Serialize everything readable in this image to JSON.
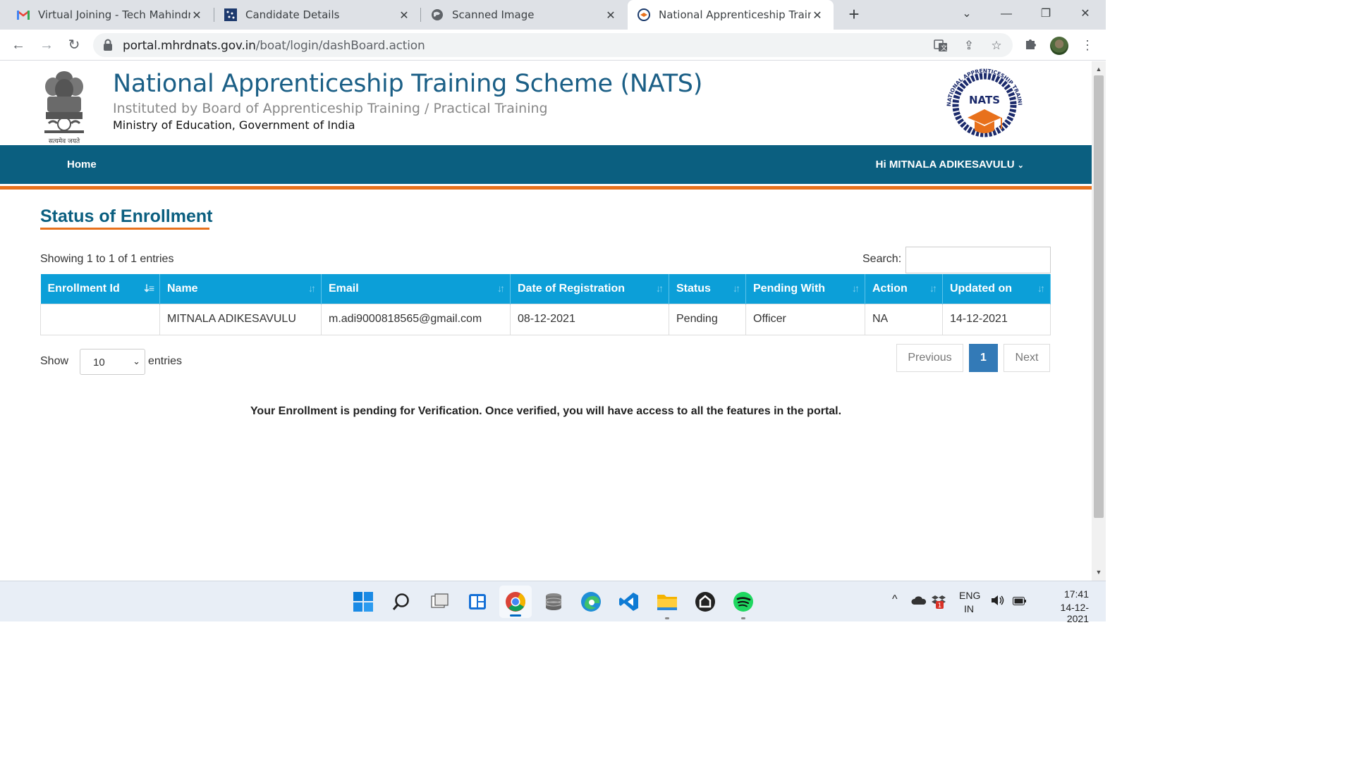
{
  "browser": {
    "tabs": [
      {
        "title": "Virtual Joining - Tech Mahindra -",
        "icon": "gmail-icon",
        "active": false
      },
      {
        "title": "Candidate Details",
        "icon": "site-icon",
        "active": false
      },
      {
        "title": "Scanned Image",
        "icon": "globe-icon",
        "active": false
      },
      {
        "title": "National Apprenticeship Training",
        "icon": "nats-favicon",
        "active": true
      }
    ],
    "url_host": "portal.mhrdnats.gov.in",
    "url_path": "/boat/login/dashBoard.action"
  },
  "header": {
    "title": "National Apprenticeship Training Scheme (NATS)",
    "subtitle": "Instituted by Board of Apprenticeship Training / Practical Training",
    "ministry": "Ministry of Education, Government of India",
    "emblem_motto": "सत्यमेव जयते",
    "logo_text": "NATS",
    "logo_ring_text": "NATIONAL APPRENTICESHIP TRAINING SCHEME"
  },
  "nav": {
    "home": "Home",
    "user": "Hi MITNALA ADIKESAVULU"
  },
  "main": {
    "section_title": "Status of Enrollment",
    "showing": "Showing 1 to 1 of 1 entries",
    "search_label": "Search:",
    "search_value": "",
    "columns": [
      "Enrollment Id",
      "Name",
      "Email",
      "Date of Registration",
      "Status",
      "Pending With",
      "Action",
      "Updated on"
    ],
    "rows": [
      {
        "enrollment_id": "",
        "name": "MITNALA ADIKESAVULU",
        "email": "m.adi9000818565@gmail.com",
        "date_of_registration": "08-12-2021",
        "status": "Pending",
        "pending_with": "Officer",
        "action": "NA",
        "updated_on": "14-12-2021"
      }
    ],
    "show_label": "Show",
    "page_size": "10",
    "entries_label": "entries",
    "pagination": {
      "previous": "Previous",
      "current": "1",
      "next": "Next"
    },
    "notice": "Your Enrollment is pending for Verification. Once verified, you will have access to all the features in the portal."
  },
  "taskbar": {
    "language": "ENG",
    "region": "IN",
    "time": "17:41",
    "date": "14-12-2021",
    "notification_count": "1"
  },
  "colors": {
    "brand_blue": "#0b5f80",
    "table_header": "#0c9fd8",
    "accent_orange": "#e8711c",
    "pager_active": "#337ab7"
  }
}
